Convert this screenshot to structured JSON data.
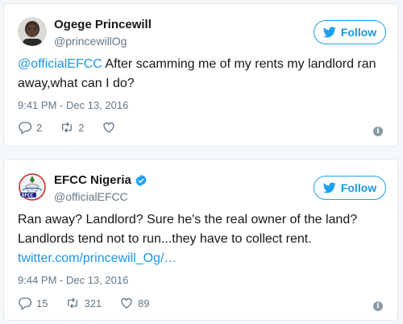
{
  "tweets": [
    {
      "author": {
        "name": "Ogege Princewill",
        "handle": "@princewillOg",
        "verified": false
      },
      "follow_label": "Follow",
      "mention": "@officialEFCC",
      "text": " After scamming me of my rents my landlord ran away,what can I do?",
      "timestamp": "9:41 PM - Dec 13, 2016",
      "counts": {
        "replies": "2",
        "retweets": "2",
        "likes": ""
      }
    },
    {
      "author": {
        "name": "EFCC Nigeria",
        "handle": "@officialEFCC",
        "verified": true
      },
      "follow_label": "Follow",
      "text": "Ran away? Landlord? Sure he's the real owner of the land? Landlords tend not to run...they have to collect rent. ",
      "link": "twitter.com/princewill_Og/…",
      "timestamp": "9:44 PM - Dec 13, 2016",
      "counts": {
        "replies": "15",
        "retweets": "321",
        "likes": "89"
      },
      "avatar_badge": "EFCC"
    }
  ],
  "colors": {
    "accent": "#1da1f2",
    "link": "#1b95e0",
    "muted": "#657786",
    "border": "#e1e8ed"
  },
  "icons": [
    "twitter-bird-icon",
    "reply-icon",
    "retweet-icon",
    "like-icon",
    "info-icon",
    "verified-badge-icon"
  ]
}
